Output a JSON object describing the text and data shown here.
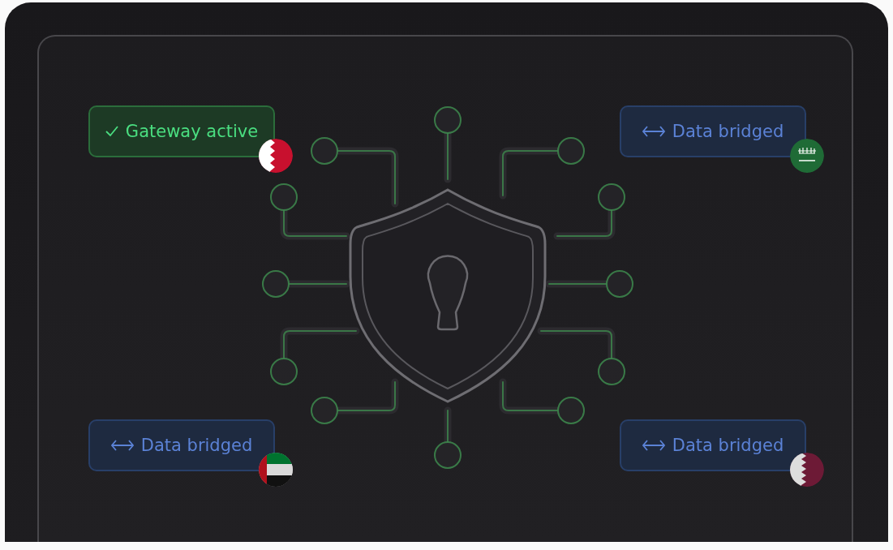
{
  "badges": [
    {
      "kind": "active",
      "label": "Gateway active",
      "flag": {
        "kind": "bahrain"
      }
    },
    {
      "kind": "bridged",
      "label": "Data bridged",
      "flag": {
        "kind": "saudi"
      }
    },
    {
      "kind": "bridged",
      "label": "Data bridged",
      "flag": {
        "kind": "uae"
      }
    },
    {
      "kind": "bridged",
      "label": "Data bridged",
      "flag": {
        "kind": "qatar"
      }
    }
  ]
}
